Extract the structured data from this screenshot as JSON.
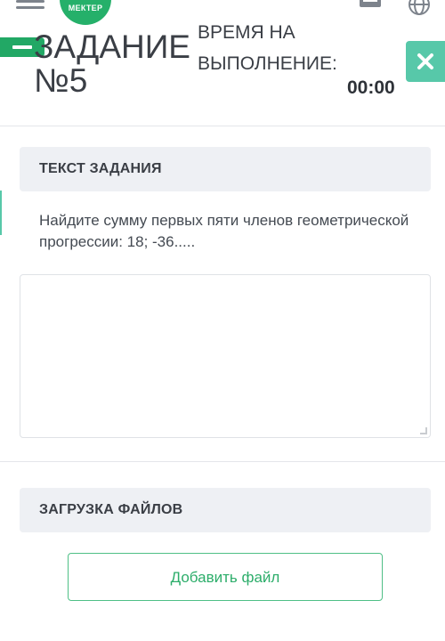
{
  "topbar": {
    "logo_text": "МЕКТЕР",
    "menu_icon": "hamburger-menu-icon",
    "list_icon": "list-icon",
    "globe_icon": "globe-icon"
  },
  "header": {
    "task_title_line1": "ЗАДАНИЕ",
    "task_title_line2": "№5",
    "time_label_line1": "ВРЕМЯ НА",
    "time_label_line2": "ВЫПОЛНЕНИЕ:",
    "time_value": "00:00",
    "close_icon": "close-icon"
  },
  "task_section": {
    "title": "ТЕКСТ ЗАДАНИЯ",
    "text": "Найдите сумму первых пяти членов геометрической прогрессии: 18; -36.....",
    "answer_value": ""
  },
  "upload_section": {
    "title": "ЗАГРУЗКА ФАЙЛОВ",
    "add_file_label": "Добавить файл"
  },
  "colors": {
    "brand_green": "#25b06a",
    "accent_teal": "#57c8a9",
    "section_bg": "#eef0f4",
    "button_text": "#2cad6a"
  }
}
